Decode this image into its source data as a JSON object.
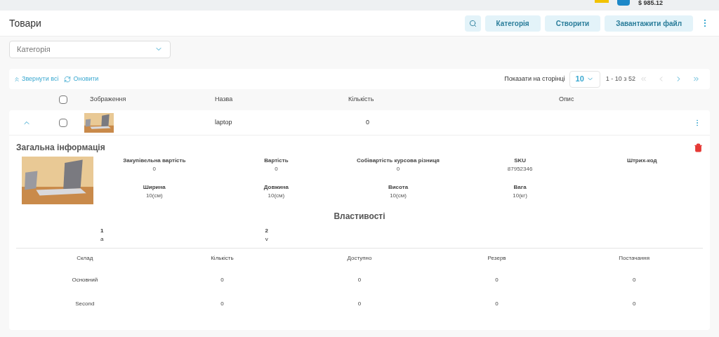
{
  "top_bar": {
    "balance": "$ 985.12"
  },
  "header": {
    "title": "Товари",
    "buttons": [
      {
        "kind": "search"
      },
      {
        "kind": "text",
        "label": "Категорія"
      },
      {
        "kind": "text",
        "label": "Створити"
      },
      {
        "kind": "text",
        "label": "Завантажити файл"
      },
      {
        "kind": "more"
      }
    ]
  },
  "filter": {
    "placeholder": "Категорія"
  },
  "toolbar": {
    "collapse": "Звернути всі",
    "refresh": "Оновити",
    "per_page_label": "Показати на сторінці",
    "per_page": "10",
    "range": "1 - 10 з 52"
  },
  "table": {
    "columns": [
      "Зображення",
      "Назва",
      "Кількість",
      "Опис"
    ],
    "header_checked": false,
    "rows": [
      {
        "name": "laptop",
        "quantity": "0",
        "expanded": true,
        "checked": false
      }
    ]
  },
  "details": {
    "title": "Загальна інформація",
    "fields": [
      {
        "label": "Закупівельна вартість",
        "value": "0"
      },
      {
        "label": "Вартість",
        "value": "0"
      },
      {
        "label": "Собівартість курсова різниця",
        "value": "0"
      },
      {
        "label": "SKU",
        "value": "87952346"
      },
      {
        "label": "Штрих-код"
      },
      {
        "label": "Ширина",
        "value": "10(см)"
      },
      {
        "label": "Довжина",
        "value": "10(см)"
      },
      {
        "label": "Висота",
        "value": "10(см)"
      },
      {
        "label": "Вага",
        "value": "10(кг)"
      }
    ],
    "properties_title": "Властивості",
    "properties": [
      {
        "label": "1",
        "value": "a"
      },
      {
        "label": "2",
        "value": "v"
      }
    ],
    "stock_columns": [
      "Склад",
      "Кількість",
      "Доступно",
      "Резерв",
      "Постачання"
    ],
    "stock_rows": [
      [
        "Основний",
        "0",
        "0",
        "0",
        "0"
      ],
      [
        "Second",
        "0",
        "0",
        "0",
        "0"
      ]
    ]
  }
}
